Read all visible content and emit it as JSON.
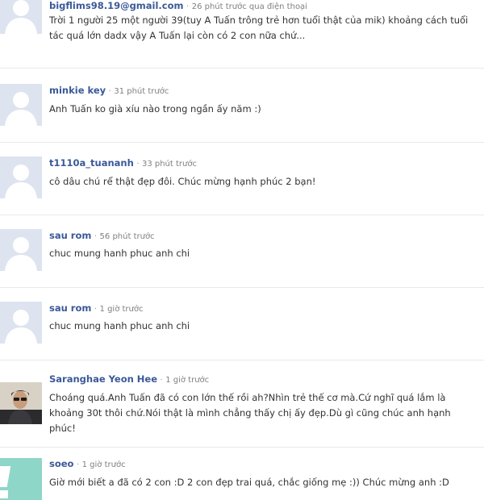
{
  "comments": [
    {
      "author": "bigflims98.19@gmail.com",
      "sep": "·",
      "time": "26 phút trước qua điện thoại",
      "text": "Trời 1 người 25 một người 39(tuy A Tuấn trông trẻ hơn tuổi thật của mik) khoảng cách tuổi tác quá lớn dadx vậy A Tuấn lại còn có 2 con nữa chứ..."
    },
    {
      "author": "minkie key",
      "sep": "·",
      "time": "31 phút trước",
      "text": "Anh Tuấn ko già xíu nào trong ngần ấy năm :)"
    },
    {
      "author": "t1110a_tuananh",
      "sep": "·",
      "time": "33 phút trước",
      "text": "cô dâu chú rể thật đẹp đôi. Chúc mừng hạnh phúc 2 bạn!"
    },
    {
      "author": "sau rom",
      "sep": "·",
      "time": "56 phút trước",
      "text": "chuc mung hanh phuc anh chi"
    },
    {
      "author": "sau rom",
      "sep": "·",
      "time": "1 giờ trước",
      "text": "chuc mung hanh phuc anh chi"
    },
    {
      "author": "Saranghae Yeon Hee",
      "sep": "·",
      "time": "1 giờ trước",
      "text": "Choáng quá.Anh Tuấn đã có con lớn thế rồi ah?Nhìn trẻ thế cơ mà.Cứ nghĩ quá lắm là khoảng 30t thôi chứ.Nói thật là mình chẳng thấy chị ấy đẹp.Dù gì cũng chúc anh hạnh phúc!"
    },
    {
      "author": "soeo",
      "sep": "·",
      "time": "1 giờ trước",
      "text": "Giờ mới biết a đã có 2 con :D 2 con đẹp trai quá, chắc giống mẹ :)) Chúc mừng anh :D"
    }
  ],
  "colors": {
    "author": "#3b5998",
    "avatar_bg": "#dde3ef",
    "avatar_silhouette": "#ffffff"
  }
}
